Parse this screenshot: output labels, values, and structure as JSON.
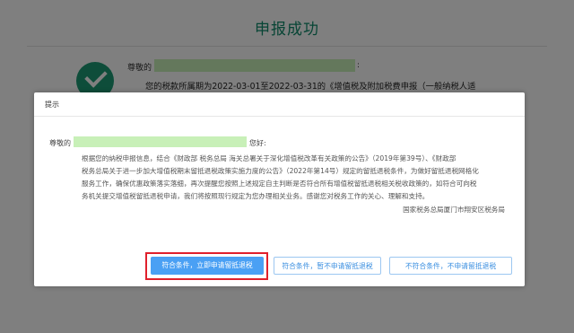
{
  "background": {
    "title": "申报成功",
    "salutation": "尊敬的",
    "colon": ":",
    "period_text": "您的税款所属期为2022-03-01至2022-03-31的《增值税及附加税费申报（一般纳税人适"
  },
  "dialog": {
    "title": "提示",
    "greeting_prefix": "尊敬的",
    "greeting_suffix": "您好:",
    "body_lines": [
      "根据您的纳税申报信息，结合《财政部 税务总局 海关总署关于深化增值税改革有关政策的公告》（2019年第39号）、《财政部",
      "税务总局关于进一步加大增值税期末留抵退税政策实施力度的公告》（2022年第14号）规定的留抵退税条件，为做好留抵退税网格化",
      "服务工作，确保优惠政策落实落细，再次提醒您按照上述规定自主判断是否符合所有增值税留抵退税相关税收政策的，如符合可向税",
      "务机关提交增值税留抵退税申请，我们将按照现行规定为您办理相关业务。感谢您对税务工作的关心、理解和支持。"
    ],
    "signature": "国家税务总局厦门市翔安区税务局",
    "buttons": {
      "apply_now": "符合条件，立即申请留抵退税",
      "not_now": "符合条件，暂不申请留抵退税",
      "not_eligible": "不符合条件，不申请留抵退税"
    }
  },
  "colors": {
    "brand_green": "#1c9b75",
    "primary_button": "#4aa0f4",
    "highlight_box": "#e0202c",
    "redaction": "#c8f0b8"
  }
}
